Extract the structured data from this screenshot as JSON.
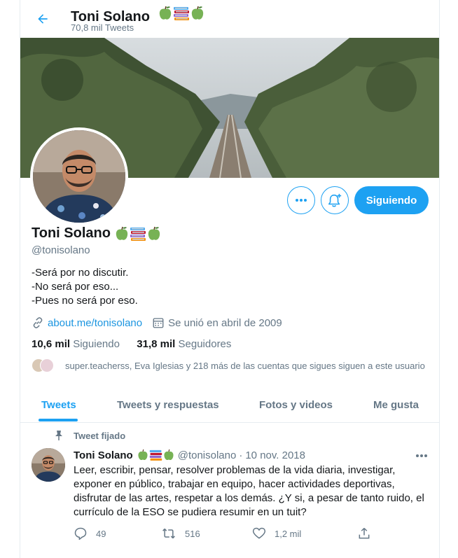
{
  "header": {
    "name": "Toni Solano",
    "tweet_count": "70,8 mil Tweets"
  },
  "profile": {
    "name": "Toni Solano",
    "handle": "@tonisolano",
    "bio": [
      "-Será por no discutir.",
      "-No será por eso...",
      "-Pues no será por eso."
    ],
    "website": "about.me/tonisolano",
    "joined": "Se unió en abril de 2009",
    "following_count": "10,6 mil",
    "following_label": "Siguiendo",
    "followers_count": "31,8 mil",
    "followers_label": "Seguidores",
    "followers_you_know": "super.teacherss, Eva Iglesias y 218 más de las cuentas que sigues siguen a este usuario",
    "name_emojis": [
      "green-apple-icon",
      "books-icon",
      "green-apple-icon"
    ]
  },
  "actions": {
    "follow_label": "Siguiendo"
  },
  "tabs": [
    {
      "label": "Tweets",
      "active": true
    },
    {
      "label": "Tweets y respuestas",
      "active": false
    },
    {
      "label": "Fotos y videos",
      "active": false
    },
    {
      "label": "Me gusta",
      "active": false
    }
  ],
  "tweet": {
    "pinned_label": "Tweet fijado",
    "author_name": "Toni Solano",
    "author_handle": "@tonisolano",
    "separator": "·",
    "date": "10 nov. 2018",
    "text": "Leer, escribir, pensar, resolver problemas de la vida diaria, investigar, exponer en público, trabajar en equipo, hacer actividades deportivas, disfrutar de las artes, respetar a los demás. ¿Y si, a pesar de tanto ruido, el currículo de la ESO se pudiera resumir en un tuit?",
    "replies": "49",
    "retweets": "516",
    "likes": "1,2 mil"
  },
  "colors": {
    "accent": "#1da1f2",
    "link": "#1b95e0",
    "secondary_text": "#657786",
    "border": "#e6ecf0"
  }
}
